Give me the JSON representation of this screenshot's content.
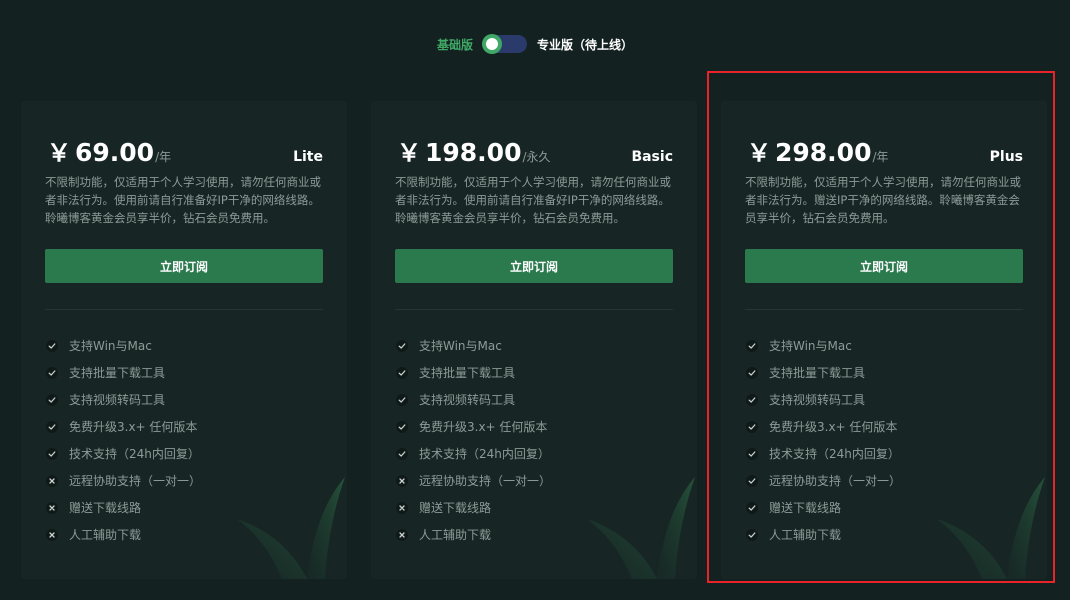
{
  "toggle": {
    "left_label": "基础版",
    "right_label": "专业版（待上线）"
  },
  "colors": {
    "background": "#132120",
    "card": "#172625",
    "accent": "#2a7a4e",
    "accent_text": "#3fa866",
    "highlight": "#e8232a"
  },
  "plans": [
    {
      "currency": "￥",
      "amount": "69.00",
      "period": "/年",
      "name": "Lite",
      "description": "不限制功能，仅适用于个人学习使用，请勿任何商业或者非法行为。使用前请自行准备好IP干净的网络线路。聆曦博客黄金会员享半价，钻石会员免费用。",
      "button": "立即订阅",
      "features": [
        {
          "text": "支持Win与Mac",
          "included": true,
          "icon": "check-icon"
        },
        {
          "text": "支持批量下载工具",
          "included": true,
          "icon": "check-icon"
        },
        {
          "text": "支持视频转码工具",
          "included": true,
          "icon": "check-icon"
        },
        {
          "text": "免费升级3.x+ 任何版本",
          "included": true,
          "icon": "check-icon"
        },
        {
          "text": "技术支持（24h内回复）",
          "included": true,
          "icon": "check-icon"
        },
        {
          "text": "远程协助支持（一对一）",
          "included": false,
          "icon": "cross-icon"
        },
        {
          "text": "赠送下载线路",
          "included": false,
          "icon": "cross-icon"
        },
        {
          "text": "人工辅助下载",
          "included": false,
          "icon": "cross-icon"
        }
      ]
    },
    {
      "currency": "￥",
      "amount": "198.00",
      "period": "/永久",
      "name": "Basic",
      "description": "不限制功能，仅适用于个人学习使用，请勿任何商业或者非法行为。使用前请自行准备好IP干净的网络线路。聆曦博客黄金会员享半价，钻石会员免费用。",
      "button": "立即订阅",
      "features": [
        {
          "text": "支持Win与Mac",
          "included": true,
          "icon": "check-icon"
        },
        {
          "text": "支持批量下载工具",
          "included": true,
          "icon": "check-icon"
        },
        {
          "text": "支持视频转码工具",
          "included": true,
          "icon": "check-icon"
        },
        {
          "text": "免费升级3.x+ 任何版本",
          "included": true,
          "icon": "check-icon"
        },
        {
          "text": "技术支持（24h内回复）",
          "included": true,
          "icon": "check-icon"
        },
        {
          "text": "远程协助支持（一对一）",
          "included": false,
          "icon": "cross-icon"
        },
        {
          "text": "赠送下载线路",
          "included": false,
          "icon": "cross-icon"
        },
        {
          "text": "人工辅助下载",
          "included": false,
          "icon": "cross-icon"
        }
      ]
    },
    {
      "currency": "￥",
      "amount": "298.00",
      "period": "/年",
      "name": "Plus",
      "description": "不限制功能，仅适用于个人学习使用，请勿任何商业或者非法行为。赠送IP干净的网络线路。聆曦博客黄金会员享半价，钻石会员免费用。",
      "button": "立即订阅",
      "features": [
        {
          "text": "支持Win与Mac",
          "included": true,
          "icon": "check-icon"
        },
        {
          "text": "支持批量下载工具",
          "included": true,
          "icon": "check-icon"
        },
        {
          "text": "支持视频转码工具",
          "included": true,
          "icon": "check-icon"
        },
        {
          "text": "免费升级3.x+ 任何版本",
          "included": true,
          "icon": "check-icon"
        },
        {
          "text": "技术支持（24h内回复）",
          "included": true,
          "icon": "check-icon"
        },
        {
          "text": "远程协助支持（一对一）",
          "included": true,
          "icon": "check-icon"
        },
        {
          "text": "赠送下载线路",
          "included": true,
          "icon": "check-icon"
        },
        {
          "text": "人工辅助下载",
          "included": true,
          "icon": "check-icon"
        }
      ]
    }
  ]
}
